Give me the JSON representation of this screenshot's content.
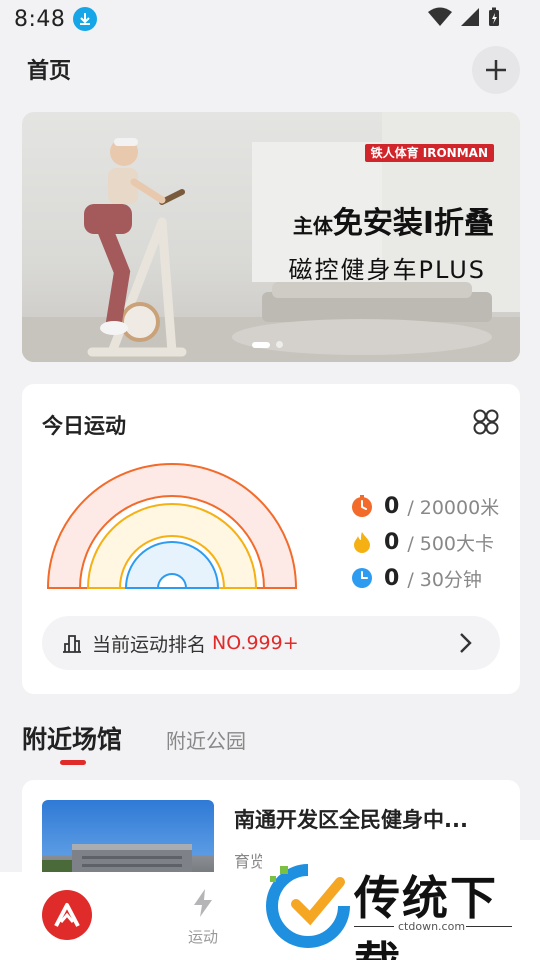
{
  "status_bar": {
    "time": "8:48"
  },
  "header": {
    "title": "首页"
  },
  "banner": {
    "brand": "铁人体育 IRONMAN",
    "line1_prefix": "主体",
    "line1_main": "免安装I折叠",
    "line2": "磁控健身车PLUS",
    "slide_count": 2,
    "active_slide": 1
  },
  "today": {
    "title": "今日运动",
    "stats": [
      {
        "icon": "stopwatch-icon",
        "value": "0",
        "goal": "/ 20000米",
        "color": "#f26b2b"
      },
      {
        "icon": "flame-icon",
        "value": "0",
        "goal": "/ 500大卡",
        "color": "#f5b014"
      },
      {
        "icon": "clock-icon",
        "value": "0",
        "goal": "/ 30分钟",
        "color": "#2d9bf0"
      }
    ],
    "ring_colors": [
      "#f26b2b",
      "#f5b014",
      "#2d9bf0"
    ],
    "rank_label": "当前运动排名",
    "rank_value": "NO.999+"
  },
  "tabs": {
    "active": "附近场馆",
    "inactive": "附近公园"
  },
  "venue": {
    "name": "南通开发区全民健身中...",
    "subtitle": "育览"
  },
  "tabbar": {
    "sport_label": "运动"
  },
  "watermark": {
    "text": "传统下载",
    "url": "ctdown.com"
  }
}
